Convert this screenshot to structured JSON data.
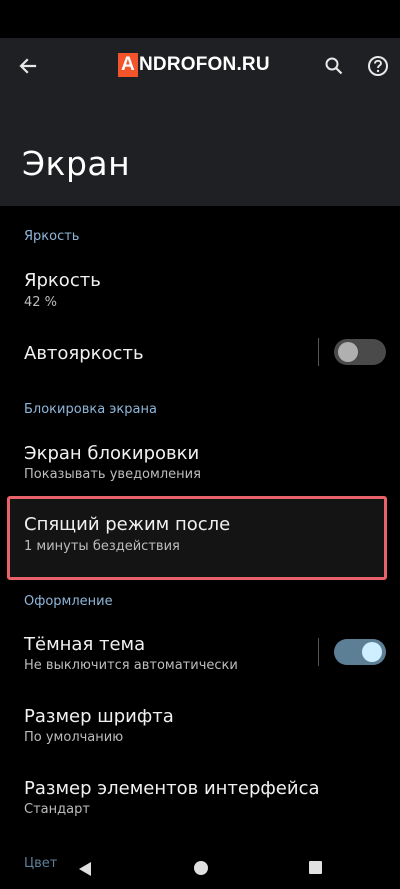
{
  "header": {
    "logo_letter": "A",
    "logo_rest": "NDROFON.RU",
    "title": "Экран"
  },
  "icons": {
    "back": "arrow-left-icon",
    "search": "search-icon",
    "help": "help-circle-icon"
  },
  "sections": {
    "brightness": "Яркость",
    "lock": "Блокировка экрана",
    "appearance": "Оформление",
    "color": "Цвет"
  },
  "items": {
    "brightness": {
      "title": "Яркость",
      "subtitle": "42 %"
    },
    "auto_brightness": {
      "title": "Автояркость",
      "enabled": false
    },
    "lock_screen": {
      "title": "Экран блокировки",
      "subtitle": "Показывать уведомления"
    },
    "sleep": {
      "title": "Спящий режим после",
      "subtitle": "1 минуты бездействия"
    },
    "dark_theme": {
      "title": "Тёмная тема",
      "subtitle": "Не выключится автоматически",
      "enabled": true
    },
    "font_size": {
      "title": "Размер шрифта",
      "subtitle": "По умолчанию"
    },
    "display_size": {
      "title": "Размер элементов интерфейса",
      "subtitle": "Стандарт"
    }
  },
  "colors": {
    "accent": "#8fb6d9",
    "highlight_border": "#e8626a",
    "header_bg": "#1f2023"
  }
}
